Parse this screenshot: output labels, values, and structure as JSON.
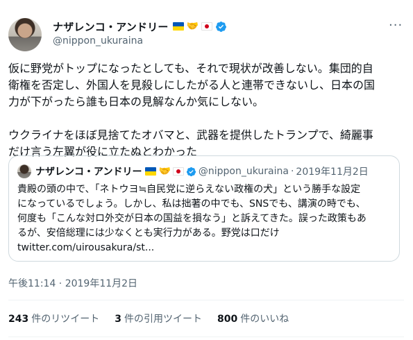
{
  "tweet": {
    "display_name": "ナザレンコ・アンドリー",
    "handle": "@nippon_ukuraina",
    "more_icon": "ellipsis-icon",
    "paragraphs": [
      "仮に野党がトップになったとしても、それで現状が改善しない。集団的自\n衛権を否定し、外国人を見殺しにしたがる人と連帯できないし、日本の国\n力が下がったら誰も日本の見解なんか気にしない。",
      "ウクライナをほぼ見捨てたオバマと、武器を提供したトランプで、綺麗事\nだけ言う左翼が役に立たぬとわかった"
    ],
    "timestamp": "午後11:14 · 2019年11月2日",
    "stats": [
      {
        "count": "243",
        "label": "件のリツイート"
      },
      {
        "count": "3",
        "label": "件の引用ツイート"
      },
      {
        "count": "800",
        "label": "件のいいね"
      }
    ]
  },
  "quote": {
    "display_name": "ナザレンコ・アンドリー",
    "handle": "@nippon_ukuraina",
    "separator": "·",
    "date": "2019年11月2日",
    "lines": [
      "貴殿の頭の中で、「ネトウヨ≒自民党に逆らえない政権の犬」という勝手な設定",
      "になっているでしょう。しかし、私は拙著の中でも、SNSでも、講演の時でも、",
      "何度も「こんな対ロ外交が日本の国益を損なう」と訴えてきた。誤った政策もあ",
      "るが、安倍総理には少なくとも実行力がある。野党は口だけ",
      "twitter.com/uirousakura/st..."
    ]
  },
  "colors": {
    "verified": "#1d9bf0",
    "muted_text": "#536471",
    "border": "#cfd9de"
  }
}
